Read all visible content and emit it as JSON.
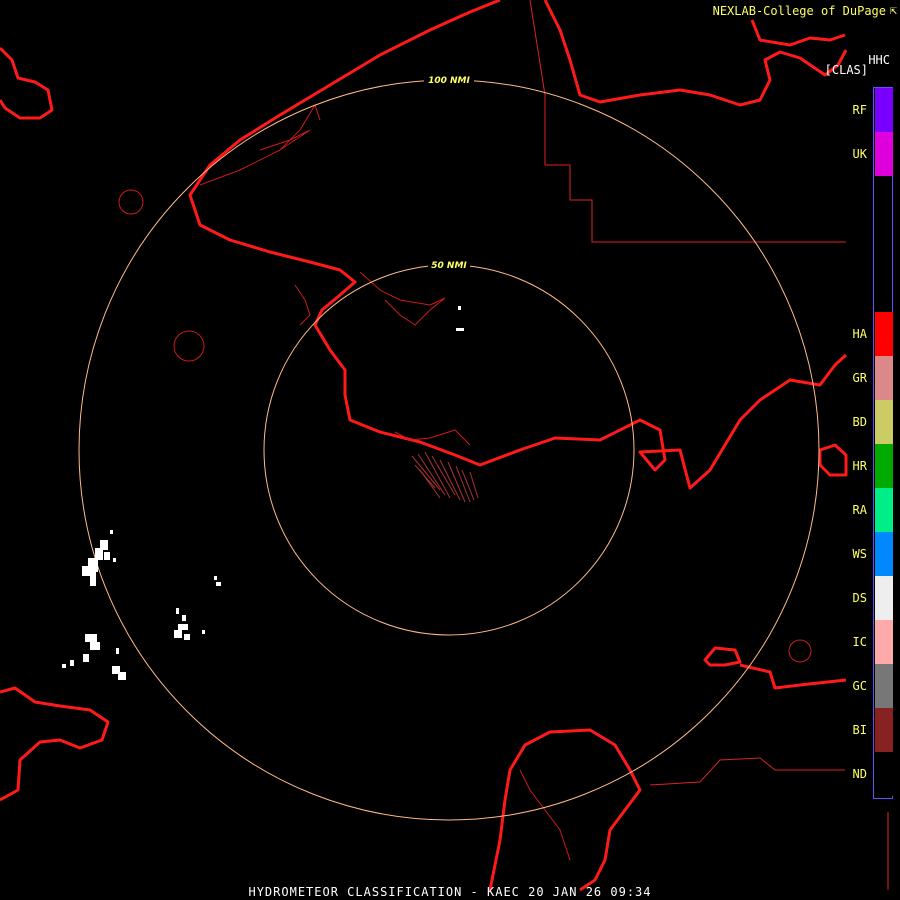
{
  "header": {
    "credit": "NEXLAB-College of DuPage",
    "credit_icon": "external-link-icon",
    "product_code": "HHC",
    "product_class": "[CLAS]"
  },
  "range_rings": [
    {
      "label": "50 NMI"
    },
    {
      "label": "100 NMI"
    }
  ],
  "legend": {
    "items": [
      {
        "code": "RF",
        "color": "#7700ff"
      },
      {
        "code": "UK",
        "color": "#dd00dd"
      },
      {
        "code": "HA",
        "color": "#ff0000"
      },
      {
        "code": "GR",
        "color": "#dd8888"
      },
      {
        "code": "BD",
        "color": "#cccc66"
      },
      {
        "code": "HR",
        "color": "#00aa00"
      },
      {
        "code": "RA",
        "color": "#00ee88"
      },
      {
        "code": "WS",
        "color": "#0088ff"
      },
      {
        "code": "DS",
        "color": "#eeeeee"
      },
      {
        "code": "IC",
        "color": "#ffaaaa"
      },
      {
        "code": "GC",
        "color": "#777777"
      },
      {
        "code": "BI",
        "color": "#882222"
      },
      {
        "code": "ND",
        "color": "#000000"
      }
    ],
    "border_color": "#6a4cff"
  },
  "colors": {
    "coastline": "#ff1a1a",
    "boundary": "#dd2222",
    "ring": "#ffbb88",
    "echo": "#ffffff",
    "clutter": "#aa3333"
  },
  "footer": {
    "title": "HYDROMETEOR CLASSIFICATION - KAEC 20 JAN 26 09:34"
  }
}
